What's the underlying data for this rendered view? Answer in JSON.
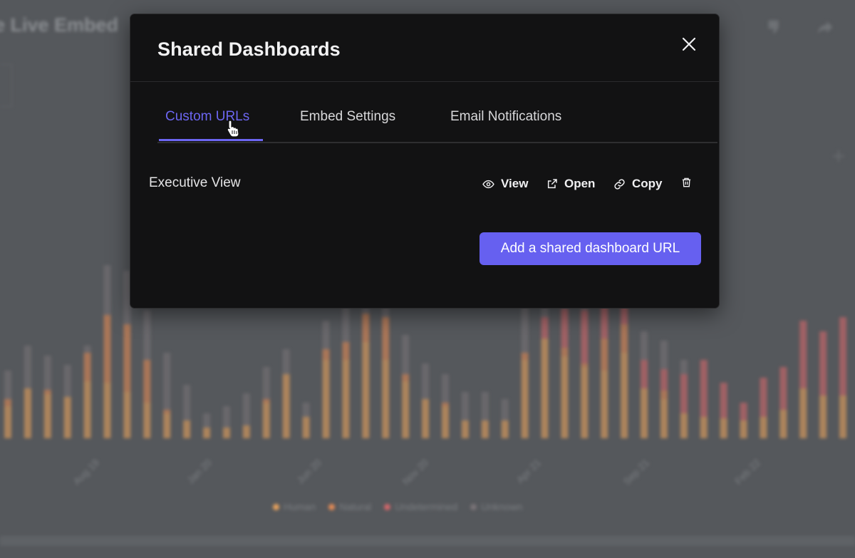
{
  "background": {
    "title": "e Live Embed",
    "axis_labels": [
      "Aug 19",
      "Jan 20",
      "Jun 20",
      "Nov 20",
      "Apr 21",
      "Sep 21",
      "Feb 22"
    ],
    "legend": [
      {
        "label": "Human",
        "color": "#e8a25c"
      },
      {
        "label": "Natural",
        "color": "#e38a55"
      },
      {
        "label": "Undetermined",
        "color": "#d2676a"
      },
      {
        "label": "Unknown",
        "color": "#7a7478"
      }
    ]
  },
  "modal": {
    "title": "Shared Dashboards",
    "tabs": [
      {
        "label": "Custom URLs",
        "active": true
      },
      {
        "label": "Embed Settings",
        "active": false
      },
      {
        "label": "Email Notifications",
        "active": false
      }
    ],
    "entries": [
      {
        "name": "Executive View",
        "actions": {
          "view": "View",
          "open": "Open",
          "copy": "Copy"
        }
      }
    ],
    "add_button": "Add a shared dashboard URL"
  },
  "colors": {
    "accent": "#6660f0",
    "modal_bg": "#121213",
    "overlay_bg": "#55585c"
  },
  "icons": {
    "close": "close-icon",
    "view": "eye-icon",
    "open": "external-link-icon",
    "copy": "link-icon",
    "delete": "trash-icon"
  }
}
